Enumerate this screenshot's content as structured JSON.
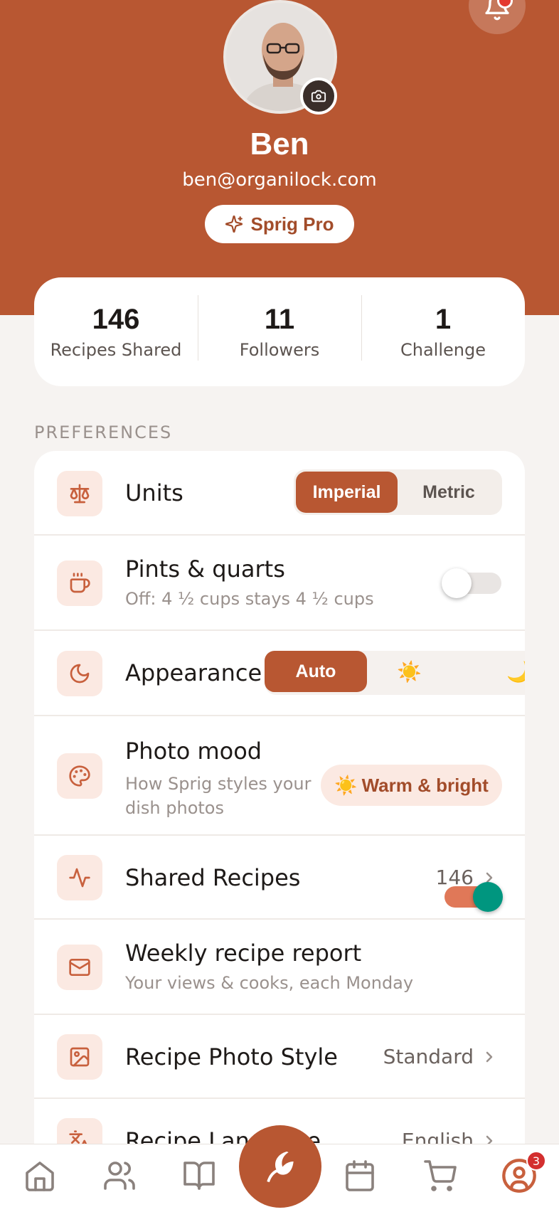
{
  "profile": {
    "name": "Ben",
    "email": "ben@organilock.com",
    "plan_label": "Sprig Pro"
  },
  "stats": [
    {
      "value": "146",
      "label": "Recipes Shared"
    },
    {
      "value": "11",
      "label": "Followers"
    },
    {
      "value": "1",
      "label": "Challenge"
    }
  ],
  "preferences": {
    "section_label": "PREFERENCES",
    "units": {
      "title": "Units",
      "options": [
        "Imperial",
        "Metric"
      ],
      "selected": "Imperial"
    },
    "pints": {
      "title": "Pints & quarts",
      "subtitle": "Off: 4 ½ cups stays 4 ½ cups",
      "enabled": false
    },
    "appearance": {
      "title": "Appearance",
      "options": [
        "Auto",
        "☀️",
        "🌙"
      ],
      "selected": "Auto"
    },
    "photo_mood": {
      "title": "Photo mood",
      "subtitle_line1": "How Sprig styles your",
      "subtitle_line2": "dish photos",
      "pill_icon": "☀️",
      "pill_label": "Warm & bright"
    },
    "shared_recipes": {
      "title": "Shared Recipes",
      "value": "146"
    },
    "weekly_report": {
      "title": "Weekly recipe report",
      "subtitle": "Your views & cooks, each Monday",
      "enabled": true
    },
    "photo_style": {
      "title": "Recipe Photo Style",
      "value": "Standard"
    },
    "language": {
      "title": "Recipe Language",
      "value": "English"
    }
  },
  "nav": {
    "items": [
      "home-icon",
      "people-icon",
      "book-icon",
      "sprig-logo-icon",
      "calendar-icon",
      "cart-icon",
      "profile-icon"
    ],
    "profile_badge": "3"
  },
  "colors": {
    "brand": "#B85732",
    "toggle_on_knob": "#00967F",
    "badge": "#D32F2F"
  }
}
